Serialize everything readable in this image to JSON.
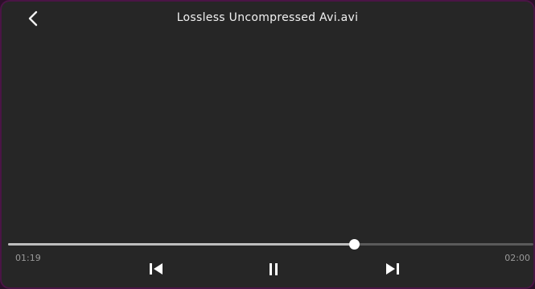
{
  "header": {
    "title": "Lossless Uncompressed Avi.avi",
    "back_icon": "chevron-left-icon"
  },
  "playback": {
    "current_time": "01:19",
    "total_time": "02:00",
    "progress_fraction": 0.658
  },
  "controls": {
    "previous_icon": "skip-previous-icon",
    "pause_icon": "pause-icon",
    "next_icon": "skip-next-icon"
  },
  "colors": {
    "background": "#262626",
    "frame_border": "#4a1545",
    "progress_fill": "#bdbdbd",
    "progress_track": "#5a5a5a",
    "thumb": "#ffffff",
    "text": "#f2f2f2",
    "time_text": "#9a9a9a"
  }
}
